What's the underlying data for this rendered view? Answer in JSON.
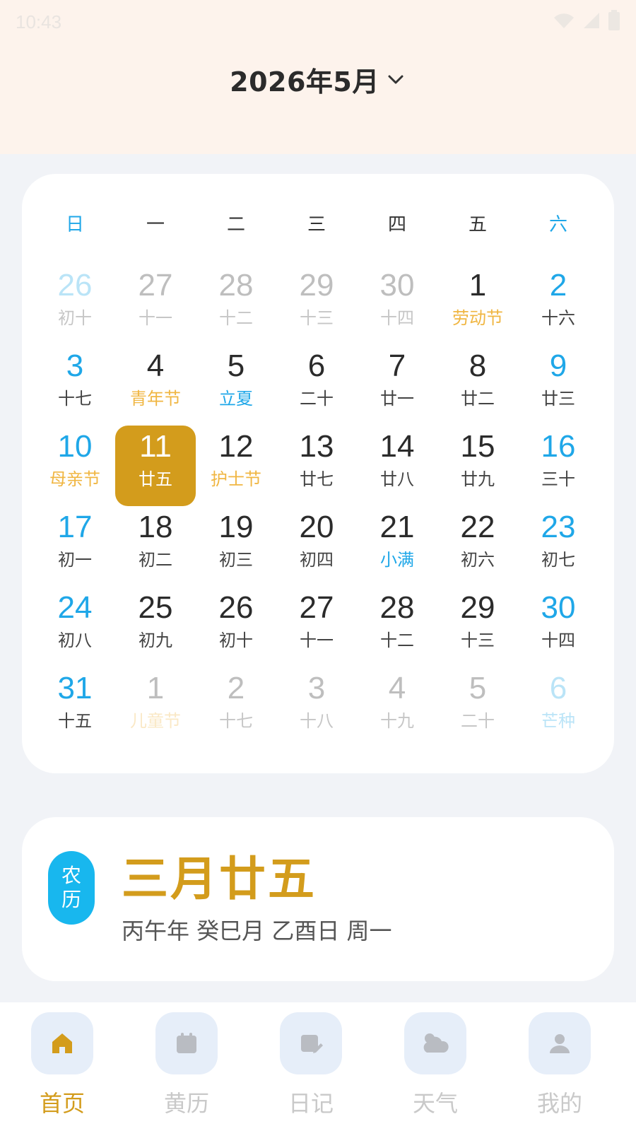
{
  "status_bar": {
    "time": "10:43"
  },
  "header": {
    "month_title": "2026年5月"
  },
  "weekdays": [
    "日",
    "一",
    "二",
    "三",
    "四",
    "五",
    "六"
  ],
  "days": [
    {
      "num": "26",
      "sub": "初十",
      "state": "outside",
      "weekend": true,
      "type": "lunar"
    },
    {
      "num": "27",
      "sub": "十一",
      "state": "outside",
      "weekend": false,
      "type": "lunar"
    },
    {
      "num": "28",
      "sub": "十二",
      "state": "outside",
      "weekend": false,
      "type": "lunar"
    },
    {
      "num": "29",
      "sub": "十三",
      "state": "outside",
      "weekend": false,
      "type": "lunar"
    },
    {
      "num": "30",
      "sub": "十四",
      "state": "outside",
      "weekend": false,
      "type": "lunar"
    },
    {
      "num": "1",
      "sub": "劳动节",
      "state": "current",
      "weekend": false,
      "type": "festival"
    },
    {
      "num": "2",
      "sub": "十六",
      "state": "current",
      "weekend": true,
      "type": "lunar"
    },
    {
      "num": "3",
      "sub": "十七",
      "state": "current",
      "weekend": true,
      "type": "lunar"
    },
    {
      "num": "4",
      "sub": "青年节",
      "state": "current",
      "weekend": false,
      "type": "festival"
    },
    {
      "num": "5",
      "sub": "立夏",
      "state": "current",
      "weekend": false,
      "type": "solar"
    },
    {
      "num": "6",
      "sub": "二十",
      "state": "current",
      "weekend": false,
      "type": "lunar"
    },
    {
      "num": "7",
      "sub": "廿一",
      "state": "current",
      "weekend": false,
      "type": "lunar"
    },
    {
      "num": "8",
      "sub": "廿二",
      "state": "current",
      "weekend": false,
      "type": "lunar"
    },
    {
      "num": "9",
      "sub": "廿三",
      "state": "current",
      "weekend": true,
      "type": "lunar"
    },
    {
      "num": "10",
      "sub": "母亲节",
      "state": "current",
      "weekend": true,
      "type": "festival"
    },
    {
      "num": "11",
      "sub": "廿五",
      "state": "selected",
      "weekend": false,
      "type": "lunar"
    },
    {
      "num": "12",
      "sub": "护士节",
      "state": "current",
      "weekend": false,
      "type": "festival"
    },
    {
      "num": "13",
      "sub": "廿七",
      "state": "current",
      "weekend": false,
      "type": "lunar"
    },
    {
      "num": "14",
      "sub": "廿八",
      "state": "current",
      "weekend": false,
      "type": "lunar"
    },
    {
      "num": "15",
      "sub": "廿九",
      "state": "current",
      "weekend": false,
      "type": "lunar"
    },
    {
      "num": "16",
      "sub": "三十",
      "state": "current",
      "weekend": true,
      "type": "lunar"
    },
    {
      "num": "17",
      "sub": "初一",
      "state": "current",
      "weekend": true,
      "type": "lunar"
    },
    {
      "num": "18",
      "sub": "初二",
      "state": "current",
      "weekend": false,
      "type": "lunar"
    },
    {
      "num": "19",
      "sub": "初三",
      "state": "current",
      "weekend": false,
      "type": "lunar"
    },
    {
      "num": "20",
      "sub": "初四",
      "state": "current",
      "weekend": false,
      "type": "lunar"
    },
    {
      "num": "21",
      "sub": "小满",
      "state": "current",
      "weekend": false,
      "type": "solar"
    },
    {
      "num": "22",
      "sub": "初六",
      "state": "current",
      "weekend": false,
      "type": "lunar"
    },
    {
      "num": "23",
      "sub": "初七",
      "state": "current",
      "weekend": true,
      "type": "lunar"
    },
    {
      "num": "24",
      "sub": "初八",
      "state": "current",
      "weekend": true,
      "type": "lunar"
    },
    {
      "num": "25",
      "sub": "初九",
      "state": "current",
      "weekend": false,
      "type": "lunar"
    },
    {
      "num": "26",
      "sub": "初十",
      "state": "current",
      "weekend": false,
      "type": "lunar"
    },
    {
      "num": "27",
      "sub": "十一",
      "state": "current",
      "weekend": false,
      "type": "lunar"
    },
    {
      "num": "28",
      "sub": "十二",
      "state": "current",
      "weekend": false,
      "type": "lunar"
    },
    {
      "num": "29",
      "sub": "十三",
      "state": "current",
      "weekend": false,
      "type": "lunar"
    },
    {
      "num": "30",
      "sub": "十四",
      "state": "current",
      "weekend": true,
      "type": "lunar"
    },
    {
      "num": "31",
      "sub": "十五",
      "state": "current",
      "weekend": true,
      "type": "lunar"
    },
    {
      "num": "1",
      "sub": "儿童节",
      "state": "outside",
      "weekend": false,
      "type": "festival"
    },
    {
      "num": "2",
      "sub": "十七",
      "state": "outside",
      "weekend": false,
      "type": "lunar"
    },
    {
      "num": "3",
      "sub": "十八",
      "state": "outside",
      "weekend": false,
      "type": "lunar"
    },
    {
      "num": "4",
      "sub": "十九",
      "state": "outside",
      "weekend": false,
      "type": "lunar"
    },
    {
      "num": "5",
      "sub": "二十",
      "state": "outside",
      "weekend": false,
      "type": "lunar"
    },
    {
      "num": "6",
      "sub": "芒种",
      "state": "outside",
      "weekend": true,
      "type": "solar"
    }
  ],
  "lunar_info": {
    "badge_line1": "农",
    "badge_line2": "历",
    "date": "三月廿五",
    "ganzhi": "丙午年 癸巳月 乙酉日 周一"
  },
  "nav": [
    {
      "label": "首页",
      "icon": "home-icon",
      "active": true
    },
    {
      "label": "黄历",
      "icon": "calendar-icon",
      "active": false
    },
    {
      "label": "日记",
      "icon": "diary-icon",
      "active": false
    },
    {
      "label": "天气",
      "icon": "weather-icon",
      "active": false
    },
    {
      "label": "我的",
      "icon": "profile-icon",
      "active": false
    }
  ],
  "colors": {
    "accent_gold": "#d39c1c",
    "weekend_blue": "#1fa7e8",
    "festival_orange": "#f0b642",
    "header_bg": "#fdf3ec",
    "page_bg": "#f1f3f7"
  }
}
